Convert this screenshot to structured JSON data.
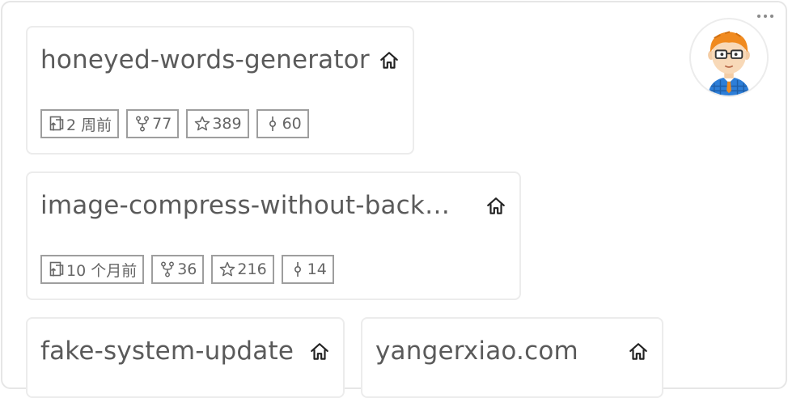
{
  "repos": [
    {
      "title": "honeyed-words-generator",
      "updated": "2 周前",
      "forks": "77",
      "stars": "389",
      "commits": "60"
    },
    {
      "title": "image-compress-without-back…",
      "updated": "10 个月前",
      "forks": "36",
      "stars": "216",
      "commits": "14"
    },
    {
      "title": "fake-system-update"
    },
    {
      "title": "yangerxiao.com"
    }
  ],
  "icons": {
    "home": "home-icon",
    "updated": "repo-upload-icon",
    "forks": "fork-icon",
    "stars": "star-icon",
    "commits": "commit-icon",
    "more": "more-dots-icon"
  },
  "colors": {
    "avatar_hair": "#f08a1f",
    "avatar_shirt": "#2d7ed8",
    "border": "#ececec",
    "badge_border": "#9e9e9e"
  }
}
